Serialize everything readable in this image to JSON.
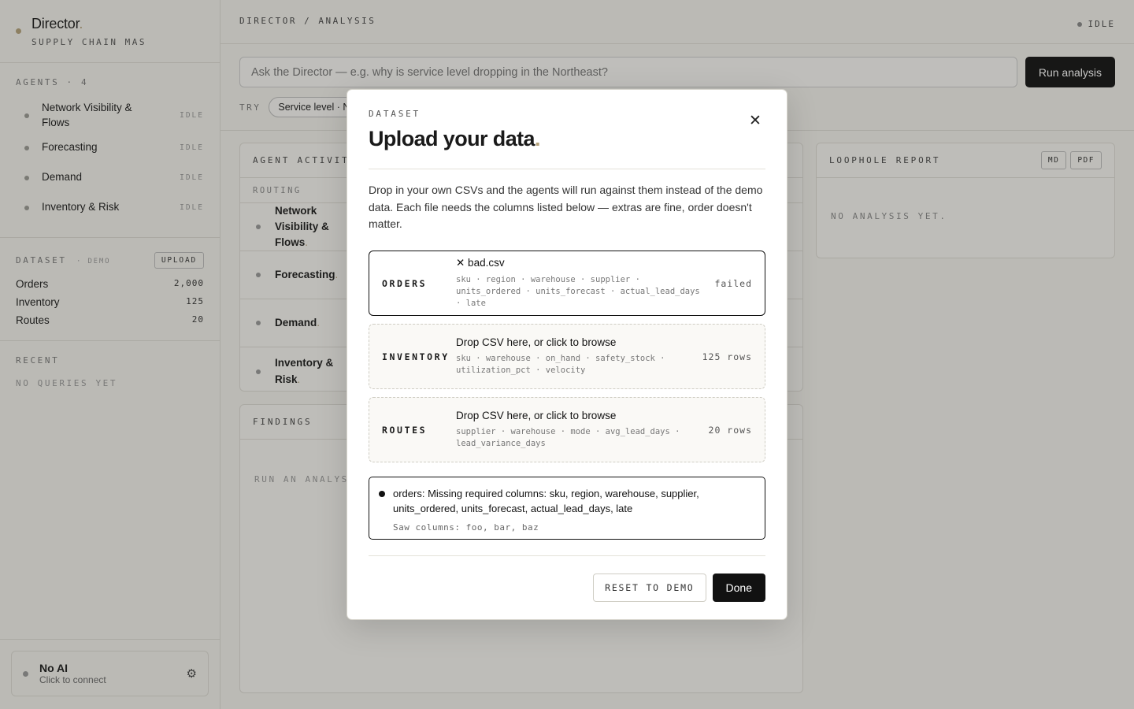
{
  "brand": {
    "title": "Director",
    "accent": ".",
    "subtitle": "SUPPLY CHAIN MAS"
  },
  "agents": {
    "label": "AGENTS · 4",
    "items": [
      {
        "name": "Network Visibility & Flows",
        "status": "IDLE"
      },
      {
        "name": "Forecasting",
        "status": "IDLE"
      },
      {
        "name": "Demand",
        "status": "IDLE"
      },
      {
        "name": "Inventory & Risk",
        "status": "IDLE"
      }
    ]
  },
  "dataset": {
    "label": "DATASET",
    "tag": "· DEMO",
    "upload_label": "UPLOAD",
    "rows": [
      {
        "name": "Orders",
        "count": "2,000"
      },
      {
        "name": "Inventory",
        "count": "125"
      },
      {
        "name": "Routes",
        "count": "20"
      }
    ]
  },
  "recent": {
    "label": "RECENT",
    "empty": "NO QUERIES YET"
  },
  "ai": {
    "title": "No AI",
    "subtitle": "Click to connect",
    "icon": "gear-icon"
  },
  "topbar": {
    "breadcrumb": "DIRECTOR / ANALYSIS",
    "status": "IDLE"
  },
  "query": {
    "placeholder": "Ask the Director — e.g. why is service level dropping in the Northeast?",
    "run_label": "Run analysis",
    "try_label": "TRY",
    "chip": "Service level · N"
  },
  "activity": {
    "title": "AGENT ACTIVITY",
    "routing": "ROUTING",
    "rows": [
      {
        "name": "Network Visibility & Flows"
      },
      {
        "name": "Forecasting"
      },
      {
        "name": "Demand"
      },
      {
        "name": "Inventory & Risk"
      }
    ],
    "accent": "."
  },
  "findings": {
    "title": "FINDINGS",
    "empty": "RUN AN ANALYSIS"
  },
  "report": {
    "title": "LOOPHOLE REPORT",
    "md_label": "MD",
    "pdf_label": "PDF",
    "empty": "NO ANALYSIS YET."
  },
  "modal": {
    "kicker": "DATASET",
    "title": "Upload your data",
    "title_accent": ".",
    "close_icon": "close-icon",
    "description": "Drop in your own CSVs and the agents will run against them instead of the demo data. Each file needs the columns listed below — extras are fine, order doesn't matter.",
    "files": [
      {
        "label": "ORDERS",
        "title": "✕ bad.csv",
        "cols": "sku · region · warehouse · supplier · units_ordered · units_forecast · actual_lead_days · late",
        "state": "failed"
      },
      {
        "label": "INVENTORY",
        "title": "Drop CSV here, or click to browse",
        "cols": "sku · warehouse · on_hand · safety_stock · utilization_pct · velocity",
        "state": "125 rows"
      },
      {
        "label": "ROUTES",
        "title": "Drop CSV here, or click to browse",
        "cols": "supplier · warehouse · mode · avg_lead_days · lead_variance_days",
        "state": "20 rows"
      }
    ],
    "error": {
      "message": "orders: Missing required columns: sku, region, warehouse, supplier, units_ordered, units_forecast, actual_lead_days, late",
      "saw": "Saw columns: foo, bar, baz"
    },
    "reset_label": "RESET TO DEMO",
    "done_label": "Done"
  }
}
